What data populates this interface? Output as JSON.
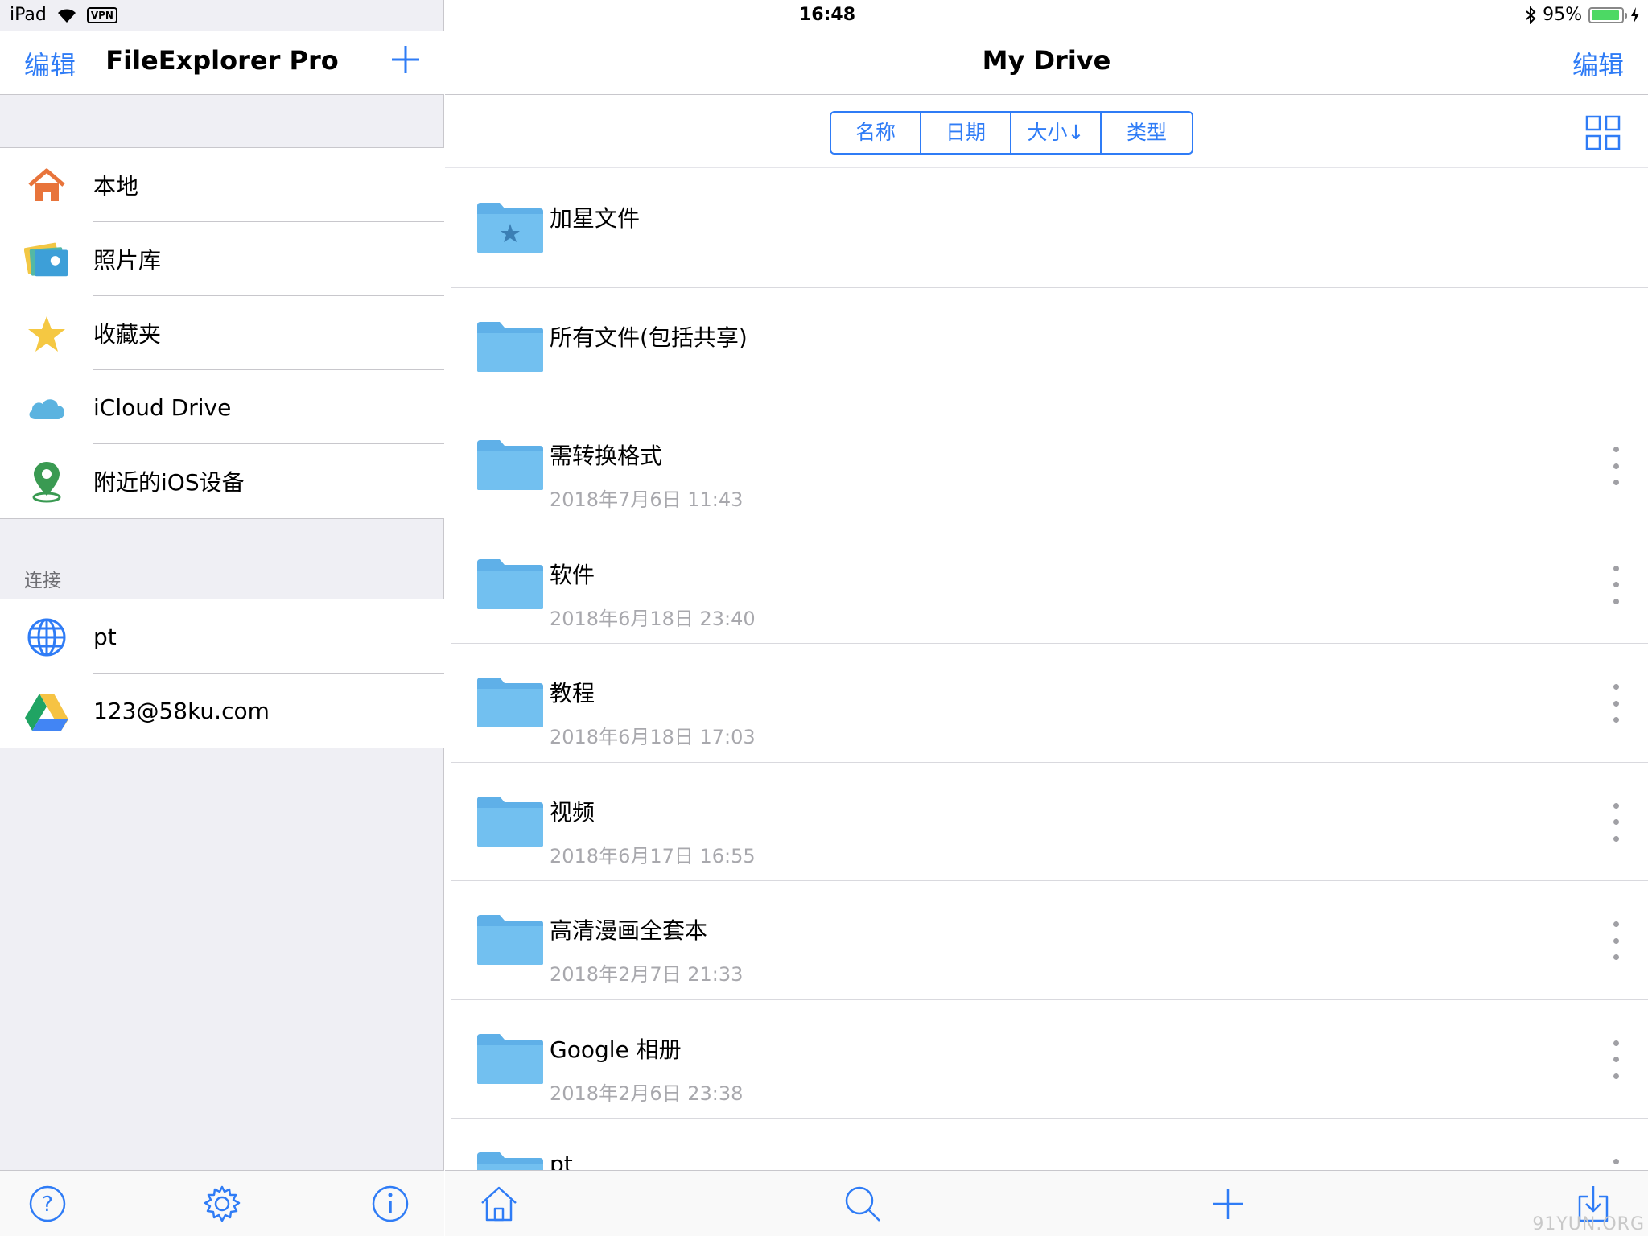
{
  "status_bar": {
    "device": "iPad",
    "vpn_badge": "VPN",
    "time": "16:48",
    "battery_percent_text": "95%",
    "battery_level": 0.95
  },
  "sidebar": {
    "edit_label": "编辑",
    "title": "FileExplorer Pro",
    "locations": [
      {
        "label": "本地",
        "icon": "home-icon"
      },
      {
        "label": "照片库",
        "icon": "photo-library-icon"
      },
      {
        "label": "收藏夹",
        "icon": "star-icon"
      },
      {
        "label": "iCloud Drive",
        "icon": "cloud-icon"
      },
      {
        "label": "附近的iOS设备",
        "icon": "location-pin-icon"
      }
    ],
    "connections_header": "连接",
    "connections": [
      {
        "label": "pt",
        "icon": "globe-icon"
      },
      {
        "label": "123@58ku.com",
        "icon": "google-drive-icon"
      }
    ],
    "toolbar_icons": [
      "help-icon",
      "settings-gear-icon",
      "info-icon"
    ]
  },
  "main": {
    "title": "My Drive",
    "edit_label": "编辑",
    "sort_options": [
      "名称",
      "日期",
      "大小↓",
      "类型"
    ],
    "files": [
      {
        "name": "加星文件",
        "date": "",
        "starred": true,
        "has_more": false
      },
      {
        "name": "所有文件(包括共享)",
        "date": "",
        "starred": false,
        "has_more": false
      },
      {
        "name": "需转换格式",
        "date": "2018年7月6日 11:43",
        "starred": false,
        "has_more": true
      },
      {
        "name": "软件",
        "date": "2018年6月18日 23:40",
        "starred": false,
        "has_more": true
      },
      {
        "name": "教程",
        "date": "2018年6月18日 17:03",
        "starred": false,
        "has_more": true
      },
      {
        "name": "视频",
        "date": "2018年6月17日 16:55",
        "starred": false,
        "has_more": true
      },
      {
        "name": "高清漫画全套本",
        "date": "2018年2月7日 21:33",
        "starred": false,
        "has_more": true
      },
      {
        "name": "Google 相册",
        "date": "2018年2月6日 23:38",
        "starred": false,
        "has_more": true
      },
      {
        "name": "pt",
        "date": "",
        "starred": false,
        "has_more": true
      }
    ],
    "toolbar_icons": [
      "home-icon",
      "search-icon",
      "add-icon",
      "download-icon"
    ],
    "watermark": "91YUN.ORG"
  },
  "colors": {
    "accent": "#2f7cf6",
    "folder": "#6cbcef",
    "sidebar_bg": "#efeff4"
  }
}
